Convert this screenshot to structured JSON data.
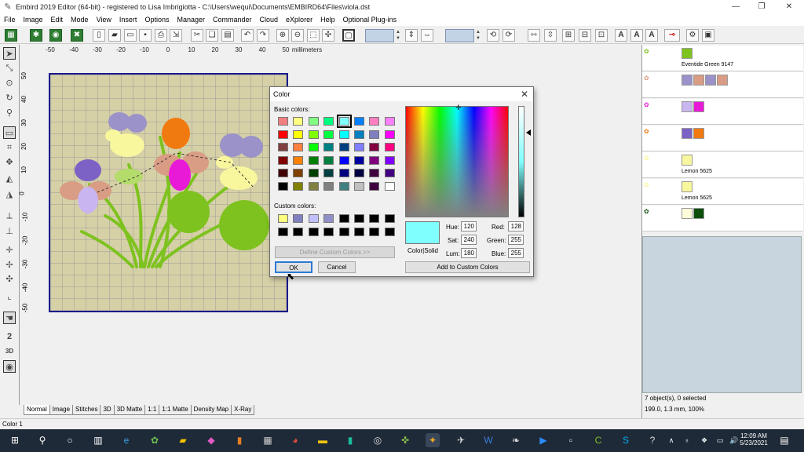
{
  "window": {
    "title": "Embird 2019 Editor (64-bit) - registered to Lisa Imbrigiotta - C:\\Users\\wequi\\Documents\\EMBIRD64\\Files\\viola.dst",
    "controls": [
      "—",
      "❐",
      "✕"
    ]
  },
  "menu": [
    "File",
    "Image",
    "Edit",
    "Mode",
    "View",
    "Insert",
    "Options",
    "Manager",
    "Commander",
    "Cloud",
    "eXplorer",
    "Help",
    "Optional Plug-ins"
  ],
  "ruler": {
    "unit": "millimeters",
    "h_ticks": [
      "-50",
      "-40",
      "-30",
      "-20",
      "-10",
      "0",
      "10",
      "20",
      "30",
      "40",
      "50"
    ],
    "v_ticks": [
      "50",
      "40",
      "30",
      "20",
      "10",
      "0",
      "-10",
      "-20",
      "-30",
      "-40",
      "-50"
    ]
  },
  "view_tabs": [
    "Normal",
    "Image",
    "Stitches",
    "3D",
    "3D Matte",
    "1:1",
    "1:1 Matte",
    "Density Map",
    "X-Ray"
  ],
  "active_tab": "Normal",
  "objects": [
    {
      "swatches": [
        "#7ec21f"
      ],
      "label": "Eventide Green 9147"
    },
    {
      "swatches": [
        "#9a92c8",
        "#d99c84",
        "#9a92c8",
        "#d99c84"
      ],
      "label": ""
    },
    {
      "swatches": [
        "#c9b5ef",
        "#e81ad8"
      ],
      "label": ""
    },
    {
      "swatches": [
        "#7d62c6",
        "#f07a10"
      ],
      "label": ""
    },
    {
      "swatches": [
        "#f8f79e"
      ],
      "label": "Lemon 5625"
    },
    {
      "swatches": [
        "#f8f79e"
      ],
      "label": "Lemon 5625"
    },
    {
      "swatches": [
        "#fcfcd8",
        "#0b4f0b"
      ],
      "label": ""
    }
  ],
  "info": {
    "selected": "7 object(s), 0 selected",
    "coords": "199.0, 1.3 mm, 100%"
  },
  "status": "Color 1",
  "color_dialog": {
    "title": "Color",
    "basic_label": "Basic colors:",
    "custom_label": "Custom colors:",
    "basic_colors": [
      "#f08080",
      "#ffff80",
      "#80ff80",
      "#00ff80",
      "#80ffff",
      "#0080ff",
      "#ff80c0",
      "#ff80ff",
      "#ff0000",
      "#ffff00",
      "#80ff00",
      "#00ff40",
      "#00ffff",
      "#0080c0",
      "#8080c0",
      "#ff00ff",
      "#804040",
      "#ff8040",
      "#00ff00",
      "#008080",
      "#004080",
      "#8080ff",
      "#800040",
      "#ff0080",
      "#800000",
      "#ff8000",
      "#008000",
      "#008040",
      "#0000ff",
      "#0000a0",
      "#800080",
      "#8000ff",
      "#400000",
      "#804000",
      "#004000",
      "#004040",
      "#000080",
      "#000040",
      "#400040",
      "#400080",
      "#000000",
      "#808000",
      "#808040",
      "#808080",
      "#408080",
      "#c0c0c0",
      "#400040",
      "#ffffff"
    ],
    "custom_colors": [
      "#ffff80",
      "#8080c0",
      "#c0c0ff",
      "#9090c8",
      "#000000",
      "#000000",
      "#000000",
      "#000000",
      "#000000",
      "#000000",
      "#000000",
      "#000000",
      "#000000",
      "#000000",
      "#000000",
      "#000000"
    ],
    "selected_basic_index": 4,
    "preview_color": "#80ffff",
    "preview_label": "Color|Solid",
    "hue_label": "Hue:",
    "hue": "120",
    "sat_label": "Sat:",
    "sat": "240",
    "lum_label": "Lum:",
    "lum": "180",
    "red_label": "Red:",
    "red": "128",
    "green_label": "Green:",
    "green": "255",
    "blue_label": "Blue:",
    "blue": "255",
    "define_button": "Define Custom Colors >>",
    "ok_button": "OK",
    "cancel_button": "Cancel",
    "add_button": "Add to Custom Colors"
  },
  "taskbar": {
    "time": "12:09 AM",
    "date": "5/23/2021"
  }
}
